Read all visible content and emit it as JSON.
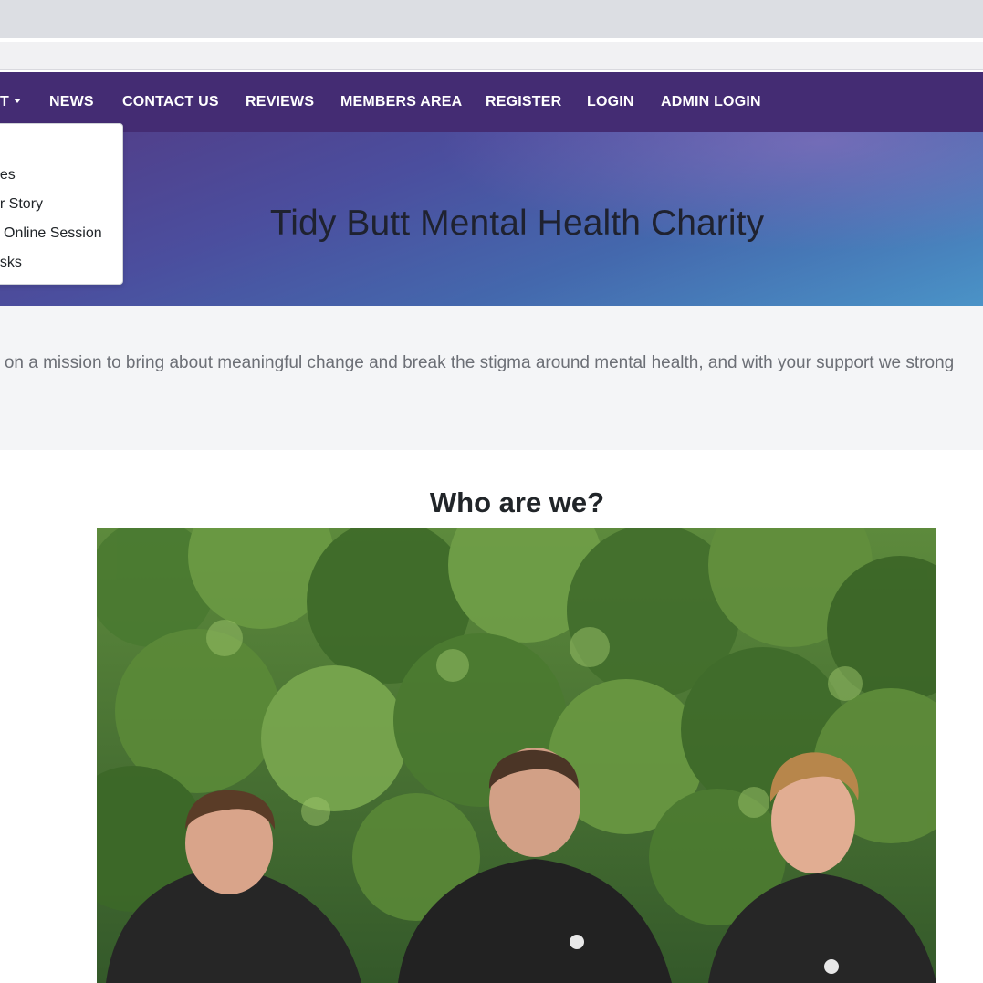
{
  "nav": {
    "items": [
      {
        "label": "T"
      },
      {
        "label": "NEWS"
      },
      {
        "label": "CONTACT US"
      },
      {
        "label": "REVIEWS"
      },
      {
        "label": "MEMBERS AREA"
      },
      {
        "label": "REGISTER"
      },
      {
        "label": "LOGIN"
      },
      {
        "label": "ADMIN LOGIN"
      }
    ]
  },
  "dropdown": {
    "items": [
      {
        "label": "ries"
      },
      {
        "label": "ur Story"
      },
      {
        "label": "Online Session"
      },
      {
        "label": "asks"
      }
    ]
  },
  "hero": {
    "title": "Tidy Butt Mental Health Charity"
  },
  "mission": {
    "text": "e on a mission to bring about meaningful change and break the stigma around mental health, and with your support we strong"
  },
  "about": {
    "heading": "Who are we?"
  },
  "colors": {
    "nav_bg": "#442c73",
    "hero_gradient_start": "#523c86",
    "hero_gradient_end": "#4a93c7",
    "mission_bg": "#f4f5f7"
  }
}
